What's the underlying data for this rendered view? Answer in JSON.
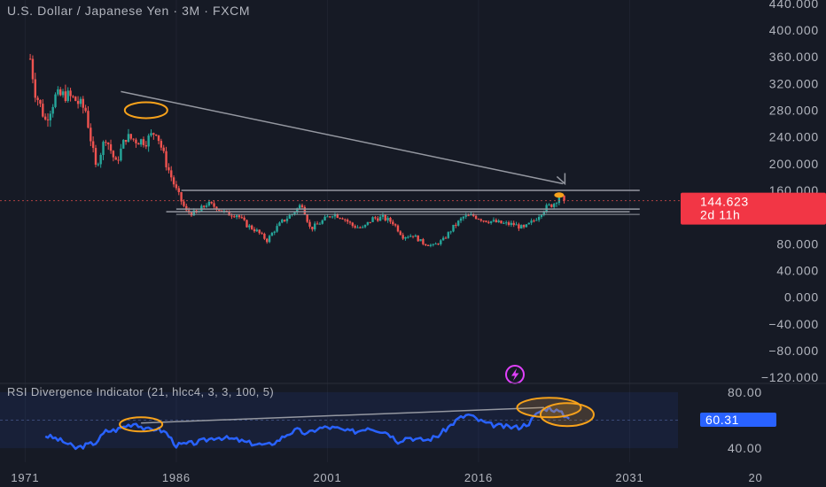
{
  "header": {
    "title": "U.S. Dollar / Japanese Yen · 3M · FXCM"
  },
  "indicator": {
    "label": "RSI Divergence Indicator (21, hlcc4, 3, 3, 100, 5)",
    "current_value": "60.31"
  },
  "price_badge": {
    "price": "144.623",
    "countdown": "2d 11h"
  },
  "colors": {
    "background": "#161a25",
    "up_candle": "#26a69a",
    "down_candle": "#ef5350",
    "rsi_line": "#2962ff",
    "highlight": "#f7a21b",
    "price_badge": "#f23645",
    "rsi_badge": "#2962ff",
    "annotation": "#9598a1",
    "flash_icon": "#e040fb"
  },
  "icons": {
    "flash": "lightning-icon"
  },
  "chart_data": [
    {
      "type": "candlestick",
      "title": "U.S. Dollar / Japanese Yen · 3M · FXCM",
      "x_ticks": [
        "1971",
        "1986",
        "2001",
        "2016",
        "2031",
        "20"
      ],
      "y_ticks": [
        "440.000",
        "400.000",
        "360.000",
        "320.000",
        "280.000",
        "240.000",
        "200.000",
        "160.000",
        "120.000",
        "80.000",
        "40.000",
        "0.000",
        "−40.000",
        "−80.000",
        "−120.000"
      ],
      "ylim": [
        -125,
        445
      ],
      "xlim": [
        1968.5,
        2038
      ],
      "last_price": 144.623,
      "series_close": [
        [
          1971.5,
          357
        ],
        [
          1972.0,
          308
        ],
        [
          1973.0,
          265
        ],
        [
          1974.0,
          300
        ],
        [
          1975.0,
          303
        ],
        [
          1976.0,
          295
        ],
        [
          1977.0,
          280
        ],
        [
          1978.0,
          195
        ],
        [
          1979.0,
          240
        ],
        [
          1980.0,
          200
        ],
        [
          1981.0,
          240
        ],
        [
          1982.0,
          235
        ],
        [
          1983.0,
          234
        ],
        [
          1984.0,
          250
        ],
        [
          1985.0,
          200
        ],
        [
          1986.0,
          160
        ],
        [
          1987.0,
          128
        ],
        [
          1988.0,
          125
        ],
        [
          1989.0,
          140
        ],
        [
          1990.0,
          135
        ],
        [
          1991.0,
          125
        ],
        [
          1992.0,
          124
        ],
        [
          1993.0,
          108
        ],
        [
          1994.0,
          99
        ],
        [
          1995.0,
          85
        ],
        [
          1995.7,
          100
        ],
        [
          1996.5,
          113
        ],
        [
          1997.5,
          125
        ],
        [
          1998.5,
          140
        ],
        [
          1999.3,
          102
        ],
        [
          2000.5,
          114
        ],
        [
          2001.5,
          125
        ],
        [
          2002.5,
          120
        ],
        [
          2003.5,
          107
        ],
        [
          2004.5,
          103
        ],
        [
          2005.5,
          118
        ],
        [
          2006.5,
          119
        ],
        [
          2007.5,
          112
        ],
        [
          2008.5,
          91
        ],
        [
          2009.5,
          93
        ],
        [
          2010.5,
          81
        ],
        [
          2011.5,
          77
        ],
        [
          2012.5,
          86
        ],
        [
          2013.5,
          105
        ],
        [
          2014.5,
          120
        ],
        [
          2015.5,
          122
        ],
        [
          2016.5,
          116
        ],
        [
          2017.5,
          113
        ],
        [
          2018.5,
          110
        ],
        [
          2019.5,
          109
        ],
        [
          2020.5,
          103
        ],
        [
          2021.5,
          115
        ],
        [
          2022.5,
          132
        ],
        [
          2023.5,
          141
        ],
        [
          2024.0,
          152
        ],
        [
          2024.5,
          144.6
        ]
      ],
      "annotations": [
        "trendline from 1982 to 2024 peak",
        "horizontal resistance at 160",
        "horizontal support band 124–132",
        "highlighted 1982 peak",
        "highlighted 2024 peak"
      ]
    },
    {
      "type": "line",
      "title": "RSI Divergence Indicator (21, hlcc4, 3, 3, 100, 5)",
      "y_ticks": [
        "80.00",
        "40.00"
      ],
      "ylim": [
        30,
        85
      ],
      "last_value": 60.31,
      "series": [
        {
          "points": [
            [
              1973.0,
              49
            ],
            [
              1974.0,
              47
            ],
            [
              1975.0,
              44
            ],
            [
              1976.0,
              40
            ],
            [
              1977.0,
              42
            ],
            [
              1978.0,
              44
            ],
            [
              1979.0,
              52
            ],
            [
              1980.0,
              53
            ],
            [
              1981.0,
              56
            ],
            [
              1982.0,
              58
            ],
            [
              1983.0,
              53
            ],
            [
              1984.0,
              54
            ],
            [
              1985.0,
              51
            ],
            [
              1986.0,
              42
            ],
            [
              1987.0,
              43
            ],
            [
              1988.0,
              44
            ],
            [
              1989.0,
              46
            ],
            [
              1990.0,
              48
            ],
            [
              1991.0,
              47
            ],
            [
              1992.0,
              46
            ],
            [
              1993.0,
              44
            ],
            [
              1994.0,
              43
            ],
            [
              1995.0,
              42
            ],
            [
              1996.0,
              45
            ],
            [
              1997.0,
              50
            ],
            [
              1998.0,
              53
            ],
            [
              1999.0,
              50
            ],
            [
              2000.0,
              54
            ],
            [
              2001.0,
              55
            ],
            [
              2002.0,
              54
            ],
            [
              2003.0,
              52
            ],
            [
              2004.0,
              52
            ],
            [
              2005.0,
              55
            ],
            [
              2006.0,
              53
            ],
            [
              2007.0,
              51
            ],
            [
              2008.0,
              45
            ],
            [
              2009.0,
              48
            ],
            [
              2010.0,
              46
            ],
            [
              2011.0,
              46
            ],
            [
              2012.0,
              49
            ],
            [
              2013.0,
              55
            ],
            [
              2014.0,
              61
            ],
            [
              2015.0,
              64
            ],
            [
              2016.0,
              60
            ],
            [
              2017.0,
              57
            ],
            [
              2018.0,
              56
            ],
            [
              2019.0,
              55
            ],
            [
              2020.0,
              55
            ],
            [
              2021.0,
              58
            ],
            [
              2022.0,
              66
            ],
            [
              2023.0,
              69
            ],
            [
              2024.0,
              66
            ],
            [
              2025.0,
              61
            ]
          ]
        }
      ],
      "annotations": [
        "divergence line from 1982 to 2024",
        "highlighted 1982 RSI peak",
        "highlighted 2024 RSI peak"
      ]
    }
  ]
}
